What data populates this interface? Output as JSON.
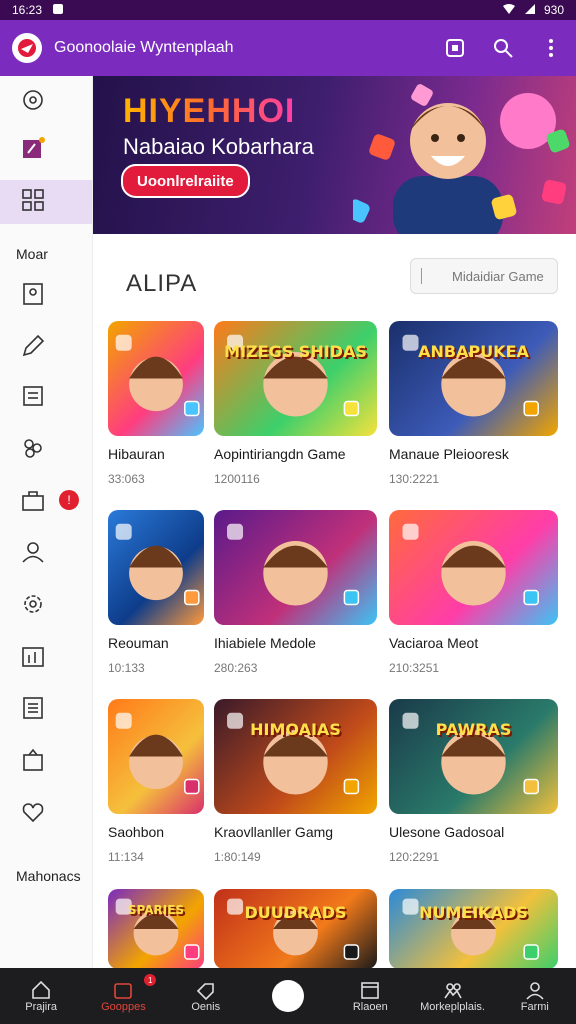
{
  "status": {
    "time": "16:23",
    "battery": "930"
  },
  "appbar": {
    "title": "Goonoolaie Wyntenplaah"
  },
  "sidebar": {
    "label_1": "Moar",
    "label_2": "Mahonacs",
    "badge": "!"
  },
  "banner": {
    "headline": "HIYEHHOI",
    "subtitle": "Nabaiao Kobarhara",
    "cta": "Uoonlrelraiite"
  },
  "section": {
    "title": "ALIPA",
    "search_placeholder": "Midaidiar Game"
  },
  "games": [
    {
      "name": "Hibauran",
      "meta": "33:063",
      "thumb_text": ""
    },
    {
      "name": "Aopintiriangdn Game",
      "meta": "1200116",
      "thumb_text": "MIZEGS SHIDAS"
    },
    {
      "name": "Manaue Pleiooresk",
      "meta": "130:2221",
      "thumb_text": "ANBAPUKEA"
    },
    {
      "name": "Reouman",
      "meta": "10:133",
      "thumb_text": ""
    },
    {
      "name": "Ihiabiele Medole",
      "meta": "280:263",
      "thumb_text": ""
    },
    {
      "name": "Vaciaroa Meot",
      "meta": "210:3251",
      "thumb_text": ""
    },
    {
      "name": "Saohbon",
      "meta": "11:134",
      "thumb_text": ""
    },
    {
      "name": "Kraovllanller Gamg",
      "meta": "1:80:149",
      "thumb_text": "HIMOAIAS"
    },
    {
      "name": "Ulesone Gadosoal",
      "meta": "120:2291",
      "thumb_text": "PAWRAS"
    },
    {
      "name": "",
      "meta": "",
      "thumb_text": "SPARIES"
    },
    {
      "name": "",
      "meta": "",
      "thumb_text": "DUUDRADS"
    },
    {
      "name": "",
      "meta": "",
      "thumb_text": "NUMEIKADS"
    }
  ],
  "bottomnav": {
    "items": [
      "Prajira",
      "Gooppes",
      "Oenis",
      "",
      "Rlaoen",
      "Morkeplplais.",
      "Farmi"
    ],
    "badge": "1"
  },
  "colors": {
    "primary": "#7b2cbf",
    "accent": "#e2453c",
    "nav_bg": "#1d1d1f"
  }
}
